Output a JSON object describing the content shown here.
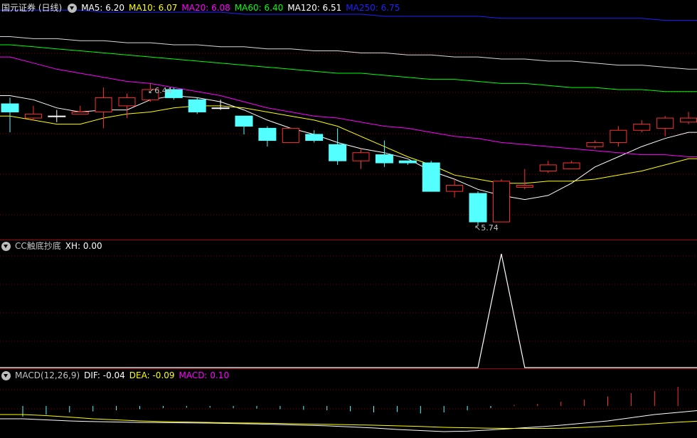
{
  "panel_main": {
    "title": "国元证券 (日线)",
    "ma_labels": [
      {
        "text": "MA5: 6.20",
        "color": "#ffffff"
      },
      {
        "text": "MA10: 6.07",
        "color": "#ffff00"
      },
      {
        "text": "MA20: 6.08",
        "color": "#ff00ff"
      },
      {
        "text": "MA60: 6.40",
        "color": "#00ff00"
      },
      {
        "text": "MA120: 6.51",
        "color": "#ffffff"
      },
      {
        "text": "MA250: 6.75",
        "color": "#2020ff"
      }
    ],
    "high_label": "6.44",
    "low_label": "5.74"
  },
  "panel_cc": {
    "title": "CC触底抄底",
    "xh_label": "XH: 0.00"
  },
  "panel_macd": {
    "title": "MACD(12,26,9)",
    "labels": [
      {
        "text": "DIF: -0.04",
        "color": "#ffffff"
      },
      {
        "text": "DEA: -0.09",
        "color": "#ffff00"
      },
      {
        "text": "MACD: 0.10",
        "color": "#ff00ff"
      }
    ]
  },
  "colors": {
    "up": "#ff3030",
    "down": "#54ffff",
    "grid": "#800000",
    "border": "#a00000",
    "ma5": "#ffffff",
    "ma10": "#ffff00",
    "ma20": "#ff00ff",
    "ma60": "#00ff00",
    "ma120": "#ffffff",
    "ma250": "#2020ff"
  },
  "chart_data": [
    {
      "type": "candlestick",
      "title": "国元证券 (日线)",
      "ylim": [
        5.68,
        6.78
      ],
      "candles": [
        {
          "open": 6.34,
          "close": 6.3,
          "high": 6.37,
          "low": 6.2
        },
        {
          "open": 6.27,
          "close": 6.29,
          "high": 6.33,
          "low": 6.26
        },
        {
          "open": 6.28,
          "close": 6.28,
          "high": 6.31,
          "low": 6.25
        },
        {
          "open": 6.29,
          "close": 6.3,
          "high": 6.33,
          "low": 6.29
        },
        {
          "open": 6.3,
          "close": 6.37,
          "high": 6.42,
          "low": 6.22
        },
        {
          "open": 6.33,
          "close": 6.37,
          "high": 6.39,
          "low": 6.27
        },
        {
          "open": 6.36,
          "close": 6.41,
          "high": 6.44,
          "low": 6.35
        },
        {
          "open": 6.41,
          "close": 6.37,
          "high": 6.42,
          "low": 6.36
        },
        {
          "open": 6.36,
          "close": 6.3,
          "high": 6.37,
          "low": 6.29
        },
        {
          "open": 6.32,
          "close": 6.32,
          "high": 6.36,
          "low": 6.31
        },
        {
          "open": 6.28,
          "close": 6.23,
          "high": 6.28,
          "low": 6.19
        },
        {
          "open": 6.22,
          "close": 6.16,
          "high": 6.23,
          "low": 6.13
        },
        {
          "open": 6.15,
          "close": 6.22,
          "high": 6.22,
          "low": 6.15
        },
        {
          "open": 6.19,
          "close": 6.16,
          "high": 6.21,
          "low": 6.15
        },
        {
          "open": 6.14,
          "close": 6.06,
          "high": 6.22,
          "low": 6.04
        },
        {
          "open": 6.06,
          "close": 6.1,
          "high": 6.12,
          "low": 6.02
        },
        {
          "open": 6.09,
          "close": 6.05,
          "high": 6.16,
          "low": 6.03
        },
        {
          "open": 6.06,
          "close": 6.05,
          "high": 6.06,
          "low": 6.04
        },
        {
          "open": 6.05,
          "close": 5.91,
          "high": 6.06,
          "low": 5.91
        },
        {
          "open": 5.91,
          "close": 5.94,
          "high": 5.97,
          "low": 5.88
        },
        {
          "open": 5.9,
          "close": 5.76,
          "high": 5.91,
          "low": 5.74
        },
        {
          "open": 5.76,
          "close": 5.96,
          "high": 5.97,
          "low": 5.76
        },
        {
          "open": 5.93,
          "close": 5.94,
          "high": 6.02,
          "low": 5.92
        },
        {
          "open": 6.01,
          "close": 6.04,
          "high": 6.06,
          "low": 6.0
        },
        {
          "open": 6.02,
          "close": 6.05,
          "high": 6.06,
          "low": 6.02
        },
        {
          "open": 6.13,
          "close": 6.15,
          "high": 6.16,
          "low": 6.12
        },
        {
          "open": 6.15,
          "close": 6.21,
          "high": 6.23,
          "low": 6.13
        },
        {
          "open": 6.21,
          "close": 6.24,
          "high": 6.26,
          "low": 6.2
        },
        {
          "open": 6.22,
          "close": 6.27,
          "high": 6.28,
          "low": 6.18
        },
        {
          "open": 6.25,
          "close": 6.27,
          "high": 6.3,
          "low": 6.24
        }
      ],
      "ma_lines": [
        {
          "name": "MA5",
          "values": [
            6.38,
            6.36,
            6.32,
            6.3,
            6.31,
            6.31,
            6.36,
            6.38,
            6.37,
            6.35,
            6.31,
            6.26,
            6.22,
            6.19,
            6.15,
            6.12,
            6.1,
            6.07,
            6.01,
            5.97,
            5.92,
            5.89,
            5.87,
            5.89,
            5.95,
            6.03,
            6.08,
            6.13,
            6.17,
            6.2
          ]
        },
        {
          "name": "MA10",
          "values": [
            6.28,
            6.26,
            6.24,
            6.24,
            6.27,
            6.29,
            6.3,
            6.32,
            6.33,
            6.33,
            6.32,
            6.3,
            6.28,
            6.26,
            6.23,
            6.18,
            6.13,
            6.08,
            6.04,
            5.99,
            5.97,
            5.95,
            5.95,
            5.96,
            5.96,
            5.97,
            5.99,
            6.01,
            6.04,
            6.07
          ]
        },
        {
          "name": "MA20",
          "values": [
            6.57,
            6.54,
            6.51,
            6.49,
            6.47,
            6.45,
            6.44,
            6.42,
            6.4,
            6.38,
            6.35,
            6.32,
            6.3,
            6.28,
            6.27,
            6.25,
            6.23,
            6.22,
            6.2,
            6.18,
            6.17,
            6.15,
            6.14,
            6.13,
            6.12,
            6.11,
            6.1,
            6.09,
            6.09,
            6.08
          ]
        },
        {
          "name": "MA60",
          "values": [
            6.63,
            6.62,
            6.61,
            6.6,
            6.59,
            6.58,
            6.57,
            6.56,
            6.55,
            6.54,
            6.53,
            6.52,
            6.51,
            6.5,
            6.49,
            6.49,
            6.48,
            6.47,
            6.46,
            6.46,
            6.45,
            6.44,
            6.44,
            6.43,
            6.42,
            6.42,
            6.41,
            6.41,
            6.4,
            6.4
          ]
        },
        {
          "name": "MA120",
          "values": [
            6.67,
            6.66,
            6.66,
            6.65,
            6.65,
            6.64,
            6.64,
            6.63,
            6.63,
            6.62,
            6.62,
            6.61,
            6.61,
            6.6,
            6.6,
            6.59,
            6.59,
            6.58,
            6.58,
            6.57,
            6.57,
            6.56,
            6.56,
            6.55,
            6.55,
            6.54,
            6.53,
            6.53,
            6.52,
            6.51
          ]
        },
        {
          "name": "MA250",
          "values": [
            6.8,
            6.8,
            6.8,
            6.8,
            6.79,
            6.79,
            6.79,
            6.79,
            6.79,
            6.79,
            6.78,
            6.78,
            6.78,
            6.78,
            6.78,
            6.78,
            6.77,
            6.77,
            6.77,
            6.77,
            6.77,
            6.76,
            6.76,
            6.76,
            6.76,
            6.76,
            6.76,
            6.76,
            6.75,
            6.75
          ]
        }
      ]
    },
    {
      "type": "line",
      "title": "CC触底抄底",
      "series": [
        {
          "name": "XH",
          "values": [
            0,
            0,
            0,
            0,
            0,
            0,
            0,
            0,
            0,
            0,
            0,
            0,
            0,
            0,
            0,
            0,
            0,
            0,
            0,
            0,
            0,
            1,
            0,
            0,
            0,
            0,
            0,
            0,
            0,
            0
          ]
        }
      ]
    },
    {
      "type": "bar",
      "title": "MACD(12,26,9)",
      "ylim": [
        -0.12,
        0.12
      ],
      "macd": [
        -0.05,
        -0.04,
        -0.03,
        -0.025,
        -0.02,
        -0.015,
        -0.01,
        -0.008,
        -0.008,
        -0.01,
        -0.012,
        -0.015,
        -0.018,
        -0.02,
        -0.025,
        -0.03,
        -0.028,
        -0.035,
        -0.03,
        -0.02,
        -0.01,
        0.005,
        0.01,
        0.02,
        0.03,
        0.045,
        0.06,
        0.07,
        0.09,
        0.1
      ],
      "series": [
        {
          "name": "DIF",
          "values": [
            -0.08,
            -0.085,
            -0.09,
            -0.093,
            -0.095,
            -0.097,
            -0.098,
            -0.099,
            -0.1,
            -0.102,
            -0.104,
            -0.107,
            -0.11,
            -0.113,
            -0.118,
            -0.123,
            -0.13,
            -0.135,
            -0.14,
            -0.138,
            -0.132,
            -0.125,
            -0.118,
            -0.11,
            -0.1,
            -0.09,
            -0.075,
            -0.06,
            -0.05,
            -0.04
          ]
        },
        {
          "name": "DEA",
          "values": [
            -0.06,
            -0.065,
            -0.072,
            -0.08,
            -0.085,
            -0.09,
            -0.093,
            -0.095,
            -0.097,
            -0.099,
            -0.1,
            -0.102,
            -0.104,
            -0.106,
            -0.108,
            -0.11,
            -0.113,
            -0.116,
            -0.12,
            -0.122,
            -0.124,
            -0.125,
            -0.125,
            -0.124,
            -0.12,
            -0.115,
            -0.11,
            -0.103,
            -0.096,
            -0.09
          ]
        }
      ]
    }
  ]
}
